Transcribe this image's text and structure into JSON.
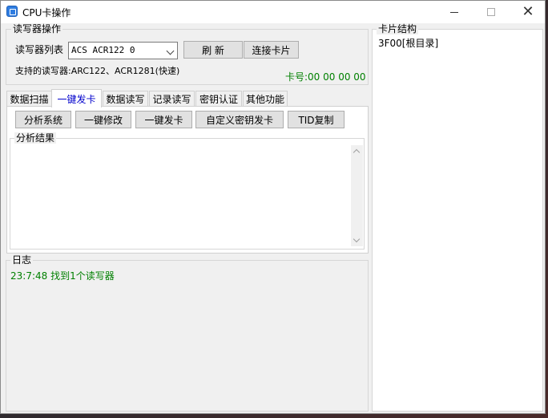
{
  "window": {
    "title": "CPU卡操作"
  },
  "reader_group": {
    "legend": "读写器操作",
    "list_label": "读写器列表",
    "selected_reader": "ACS ACR122 0",
    "refresh_label": "刷 新",
    "connect_label": "连接卡片",
    "supported_label": "支持的读写器:ARC122、ACR1281(快速)",
    "card_number": "卡号:00 00 00 00"
  },
  "tabs": [
    {
      "label": "数据扫描"
    },
    {
      "label": "一键发卡",
      "active": true
    },
    {
      "label": "数据读写"
    },
    {
      "label": "记录读写"
    },
    {
      "label": "密钥认证"
    },
    {
      "label": "其他功能"
    }
  ],
  "actions": {
    "analyze": "分析系统",
    "quick_modify": "一键修改",
    "quick_issue": "一键发卡",
    "custom_key_issue": "自定义密钥发卡",
    "tid_copy": "TID复制"
  },
  "analysis": {
    "legend": "分析结果"
  },
  "log": {
    "legend": "日志",
    "entries": [
      "23:7:48 找到1个读写器"
    ]
  },
  "card_structure": {
    "legend": "卡片结构",
    "root": "3F00[根目录]"
  },
  "colors": {
    "success_text": "#008000",
    "active_tab_text": "#0000cc"
  }
}
